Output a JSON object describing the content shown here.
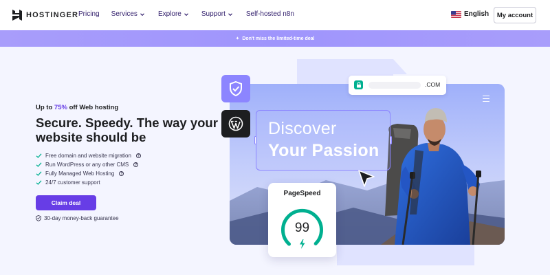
{
  "brand": {
    "name": "HOSTINGER"
  },
  "nav": {
    "items": [
      {
        "label": "Pricing",
        "has_dropdown": false
      },
      {
        "label": "Services",
        "has_dropdown": true
      },
      {
        "label": "Explore",
        "has_dropdown": true
      },
      {
        "label": "Support",
        "has_dropdown": true
      },
      {
        "label": "Self-hosted n8n",
        "has_dropdown": false
      }
    ],
    "language": {
      "label": "English",
      "flag": "us-flag-icon"
    },
    "account_button": "My account"
  },
  "promo": {
    "text": "Don't miss the limited-time deal",
    "icon": "sparkle-icon"
  },
  "hero": {
    "kicker_prefix": "Up to ",
    "kicker_percent": "75%",
    "kicker_suffix": " off Web hosting",
    "headline": "Secure. Speedy. The way your website should be",
    "features": [
      {
        "label": "Free domain and website migration",
        "has_info": true
      },
      {
        "label": "Run WordPress or any other CMS",
        "has_info": true
      },
      {
        "label": "Fully Managed Web Hosting",
        "has_info": true
      },
      {
        "label": "24/7 customer support",
        "has_info": false
      }
    ],
    "cta": "Claim deal",
    "guarantee": "30-day money-back guarantee"
  },
  "illustration": {
    "url_tld": ".COM",
    "discover_line1": "Discover",
    "discover_line2": "Your Passion",
    "pagespeed_title": "PageSpeed",
    "pagespeed_score": "99",
    "pagespeed_fraction": 0.99
  },
  "colors": {
    "accent": "#673de6",
    "promo_bg": "#a29bfe",
    "badge_purple": "#8c85ff",
    "gauge_green": "#00b090",
    "page_bg": "#f4f5ff"
  }
}
